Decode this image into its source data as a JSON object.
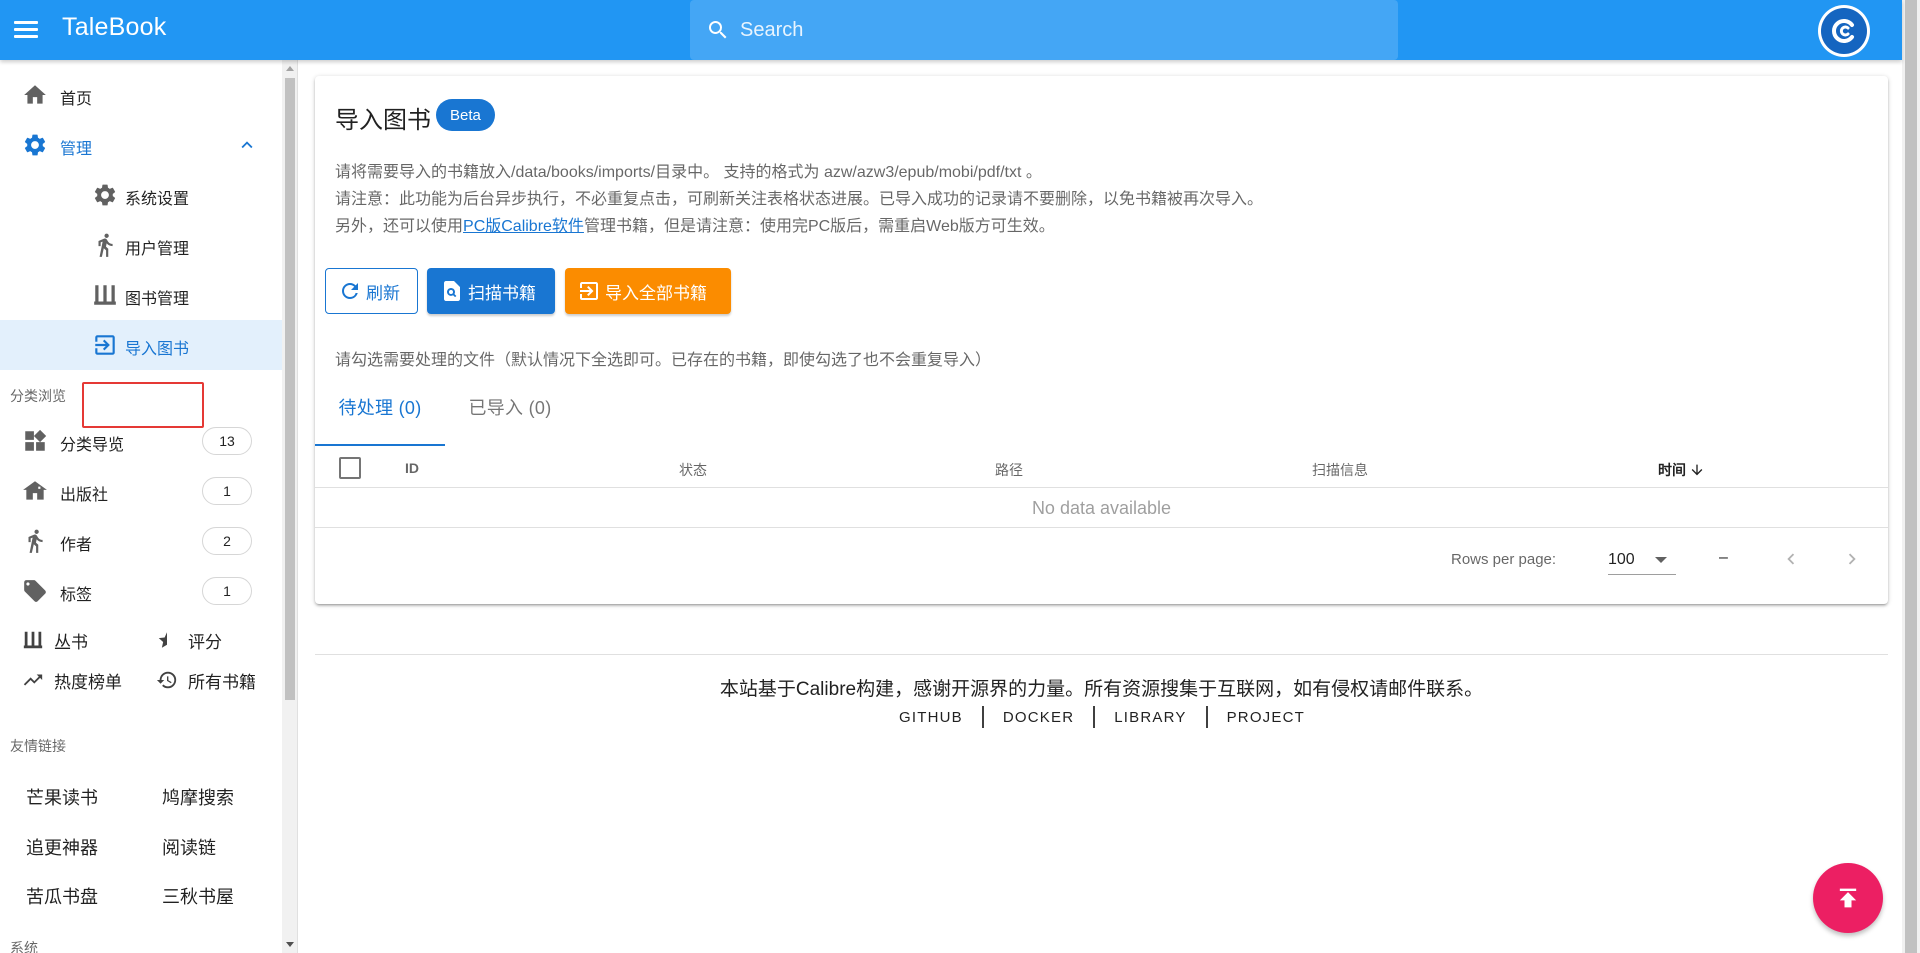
{
  "app": {
    "title": "TaleBook"
  },
  "search": {
    "placeholder": "Search"
  },
  "sidebar": {
    "home": "首页",
    "admin": "管理",
    "admin_items": [
      "系统设置",
      "用户管理",
      "图书管理",
      "导入图书"
    ],
    "browse_header": "分类浏览",
    "categories": [
      {
        "label": "分类导览",
        "count": "13"
      },
      {
        "label": "出版社",
        "count": "1"
      },
      {
        "label": "作者",
        "count": "2"
      },
      {
        "label": "标签",
        "count": "1"
      }
    ],
    "series": "丛书",
    "rating": "评分",
    "hot": "热度榜单",
    "all_books": "所有书籍",
    "links_header": "友情链接",
    "links": [
      "芒果读书",
      "鸠摩搜索",
      "追更神器",
      "阅读链",
      "苦瓜书盘",
      "三秋书屋"
    ],
    "system_header": "系统"
  },
  "main": {
    "title": "导入图书",
    "badge": "Beta",
    "desc1": "请将需要导入的书籍放入/data/books/imports/目录中。 支持的格式为 azw/azw3/epub/mobi/pdf/txt 。",
    "desc2": "请注意：此功能为后台异步执行，不必重复点击，可刷新关注表格状态进展。已导入成功的记录请不要删除，以免书籍被再次导入。",
    "desc3_pre": "另外，还可以使用",
    "desc3_link": "PC版Calibre软件",
    "desc3_post": "管理书籍，但是请注意：使用完PC版后，需重启Web版方可生效。",
    "buttons": {
      "refresh": "刷新",
      "scan": "扫描书籍",
      "import_all": "导入全部书籍"
    },
    "hint": "请勾选需要处理的文件（默认情况下全选即可。已存在的书籍，即使勾选了也不会重复导入）",
    "tabs": [
      "待处理 (0)",
      "已导入 (0)"
    ],
    "columns": [
      "ID",
      "状态",
      "路径",
      "扫描信息",
      "时间"
    ],
    "no_data": "No data available",
    "rows_per_page_label": "Rows per page:",
    "rows_per_page": "100",
    "range": "–"
  },
  "footer": {
    "text": "本站基于Calibre构建，感谢开源界的力量。所有资源搜集于互联网，如有侵权请邮件联系。",
    "links": [
      "GITHUB",
      "DOCKER",
      "LIBRARY",
      "PROJECT"
    ]
  },
  "colors": {
    "primary": "#2196f3",
    "accent": "#1976d2",
    "orange": "#fb8c00",
    "fab": "#ec1f63",
    "highlight": "#e53935"
  },
  "icons": [
    "menu-icon",
    "search-icon",
    "home-icon",
    "gear-icon",
    "chevron-up-icon",
    "person-icon",
    "bookshelf-icon",
    "import-icon",
    "widgets-icon",
    "publisher-icon",
    "tag-icon",
    "star-half-icon",
    "trending-icon",
    "history-icon",
    "refresh-icon",
    "scan-icon",
    "arrow-down-icon",
    "chevron-left-icon",
    "chevron-right-icon",
    "arrow-up-icon"
  ]
}
